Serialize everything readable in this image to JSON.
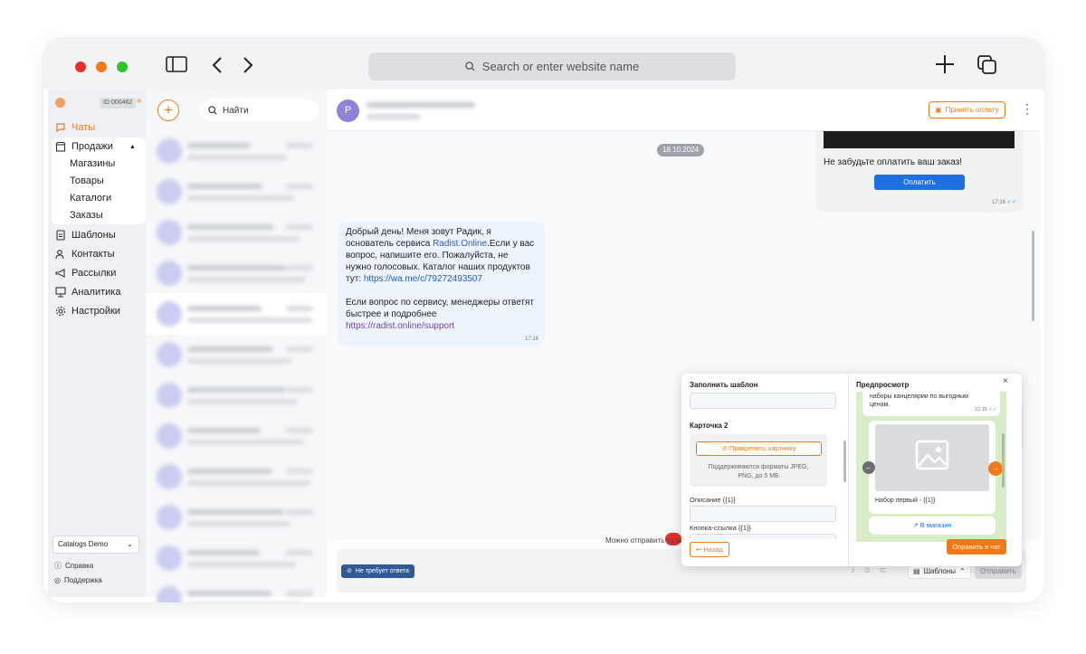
{
  "browser": {
    "address_placeholder": "Search or enter website name"
  },
  "sidebar": {
    "id_badge": "ID:000462",
    "nav": {
      "chats": "Чаты",
      "sales": "Продажи",
      "templates": "Шаблоны",
      "contacts": "Контакты",
      "mailings": "Рассылки",
      "analytics": "Аналитика",
      "settings": "Настройки"
    },
    "sales_sub": [
      "Магазины",
      "Товары",
      "Каталоги",
      "Заказы"
    ],
    "catalog_select": "Catalogs Demo",
    "help": "Справка",
    "support": "Поддержка"
  },
  "chatlist": {
    "search_placeholder": "Найти"
  },
  "chat": {
    "avatar_letter": "P",
    "accept_payment": "Принять оплату",
    "date_chip": "18.10.2024",
    "order_reminder": "Не забудьте оплатить ваш заказ!",
    "pay_button": "Оплатить",
    "order_time": "17:16",
    "message": {
      "line1": "Добрый день! Меня зовут Радик, я",
      "line2_pre": "основатель сервиса ",
      "line2_link": "Radist.Online",
      "line2_post": ".Если у вас",
      "line3": "вопрос, напишите его. Пожалуйста, не",
      "line4": "нужно голосовых. Каталог наших продуктов",
      "line5_pre": "тут: ",
      "line5_link": "https://wa.me/c/79272493507",
      "line6": "Если вопрос по сервису, менеджеры ответят",
      "line7": "быстрее и подробнее",
      "line8_link": "https://radist.online/support",
      "time": "17:16"
    },
    "composer_hint": "Можно отправить толь",
    "no_reply_button": "Не требует ответа",
    "templates_button": "Шаблоны",
    "send_button": "Отправить"
  },
  "template_modal": {
    "fill_title": "Заполнить шаблон",
    "card_label": "Карточка 2",
    "attach_button": "Прикрепить картинку",
    "formats_line1": "Поддерживаются форматы JPEG,",
    "formats_line2": "PNG, до 5 МБ",
    "description_label": "Описание {{1}}",
    "button_link_label": "Кнопка-ссылка {{1}}",
    "back_button": "Назад",
    "preview_title": "Предпросмотр",
    "preview_text_line1": "наборы канцелярии по выгодным",
    "preview_text_line2": "ценам.",
    "preview_time": "12:15",
    "card_caption": "Набор первый - {{1}}",
    "store_button": "В магазин",
    "send_to_chat": "Оправить в чат"
  },
  "colors": {
    "accent": "#f07a1a",
    "blue": "#1f6fe0",
    "nav_blue": "#2f5a96",
    "sidebar_bg": "#eff0f3"
  }
}
